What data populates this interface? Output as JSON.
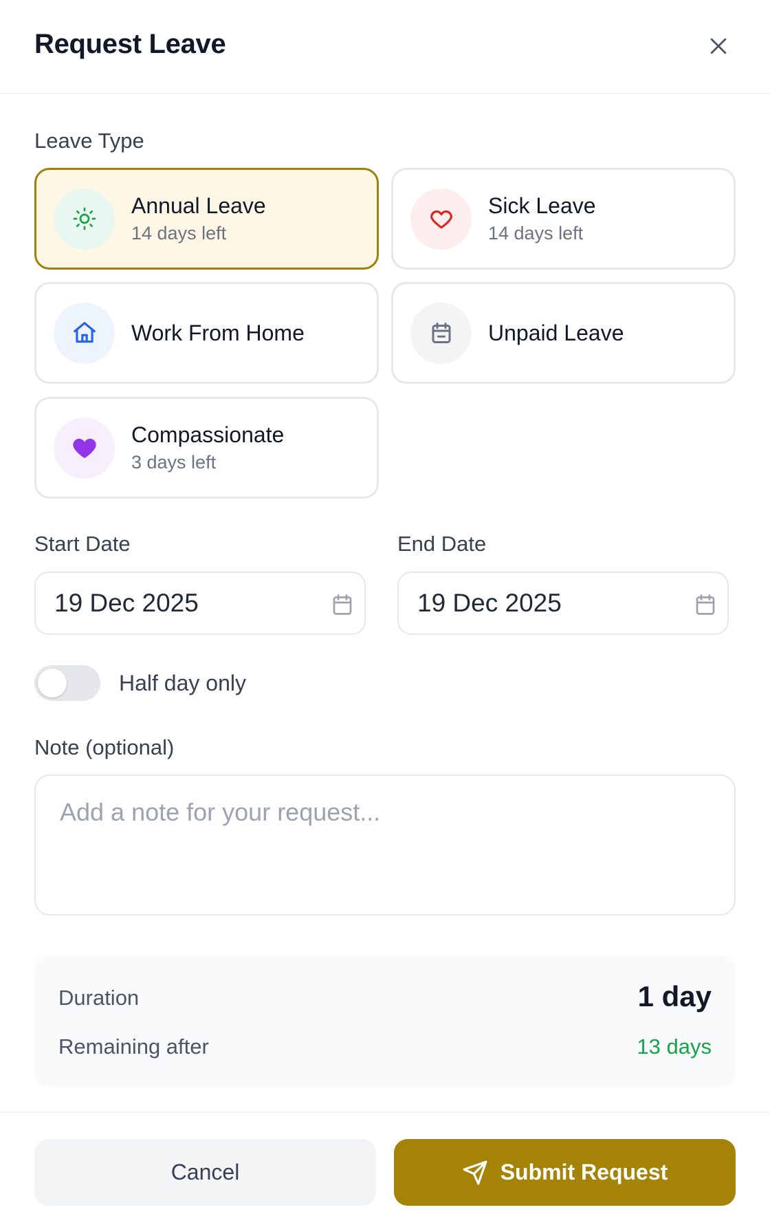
{
  "header": {
    "title": "Request Leave"
  },
  "leave_type": {
    "label": "Leave Type",
    "options": [
      {
        "name": "Annual Leave",
        "sub": "14 days left",
        "icon": "sun-icon",
        "selected": true
      },
      {
        "name": "Sick Leave",
        "sub": "14 days left",
        "icon": "heart-outline-icon"
      },
      {
        "name": "Work From Home",
        "sub": "",
        "icon": "home-icon"
      },
      {
        "name": "Unpaid Leave",
        "sub": "",
        "icon": "calendar-minus-icon"
      },
      {
        "name": "Compassionate",
        "sub": "3 days left",
        "icon": "heart-filled-icon"
      }
    ]
  },
  "dates": {
    "start_label": "Start Date",
    "start_value": "19 Dec 2025",
    "end_label": "End Date",
    "end_value": "19 Dec 2025"
  },
  "half_day": {
    "label": "Half day only",
    "enabled": false
  },
  "note": {
    "label": "Note (optional)",
    "placeholder": "Add a note for your request...",
    "value": ""
  },
  "summary": {
    "duration_label": "Duration",
    "duration_value": "1 day",
    "remaining_label": "Remaining after",
    "remaining_value": "13 days"
  },
  "footer": {
    "cancel_label": "Cancel",
    "submit_label": "Submit Request"
  },
  "colors": {
    "accent": "#a48306",
    "selected_border": "#a0800a",
    "selected_bg": "#fef7e6",
    "remaining_green": "#16a34a"
  }
}
